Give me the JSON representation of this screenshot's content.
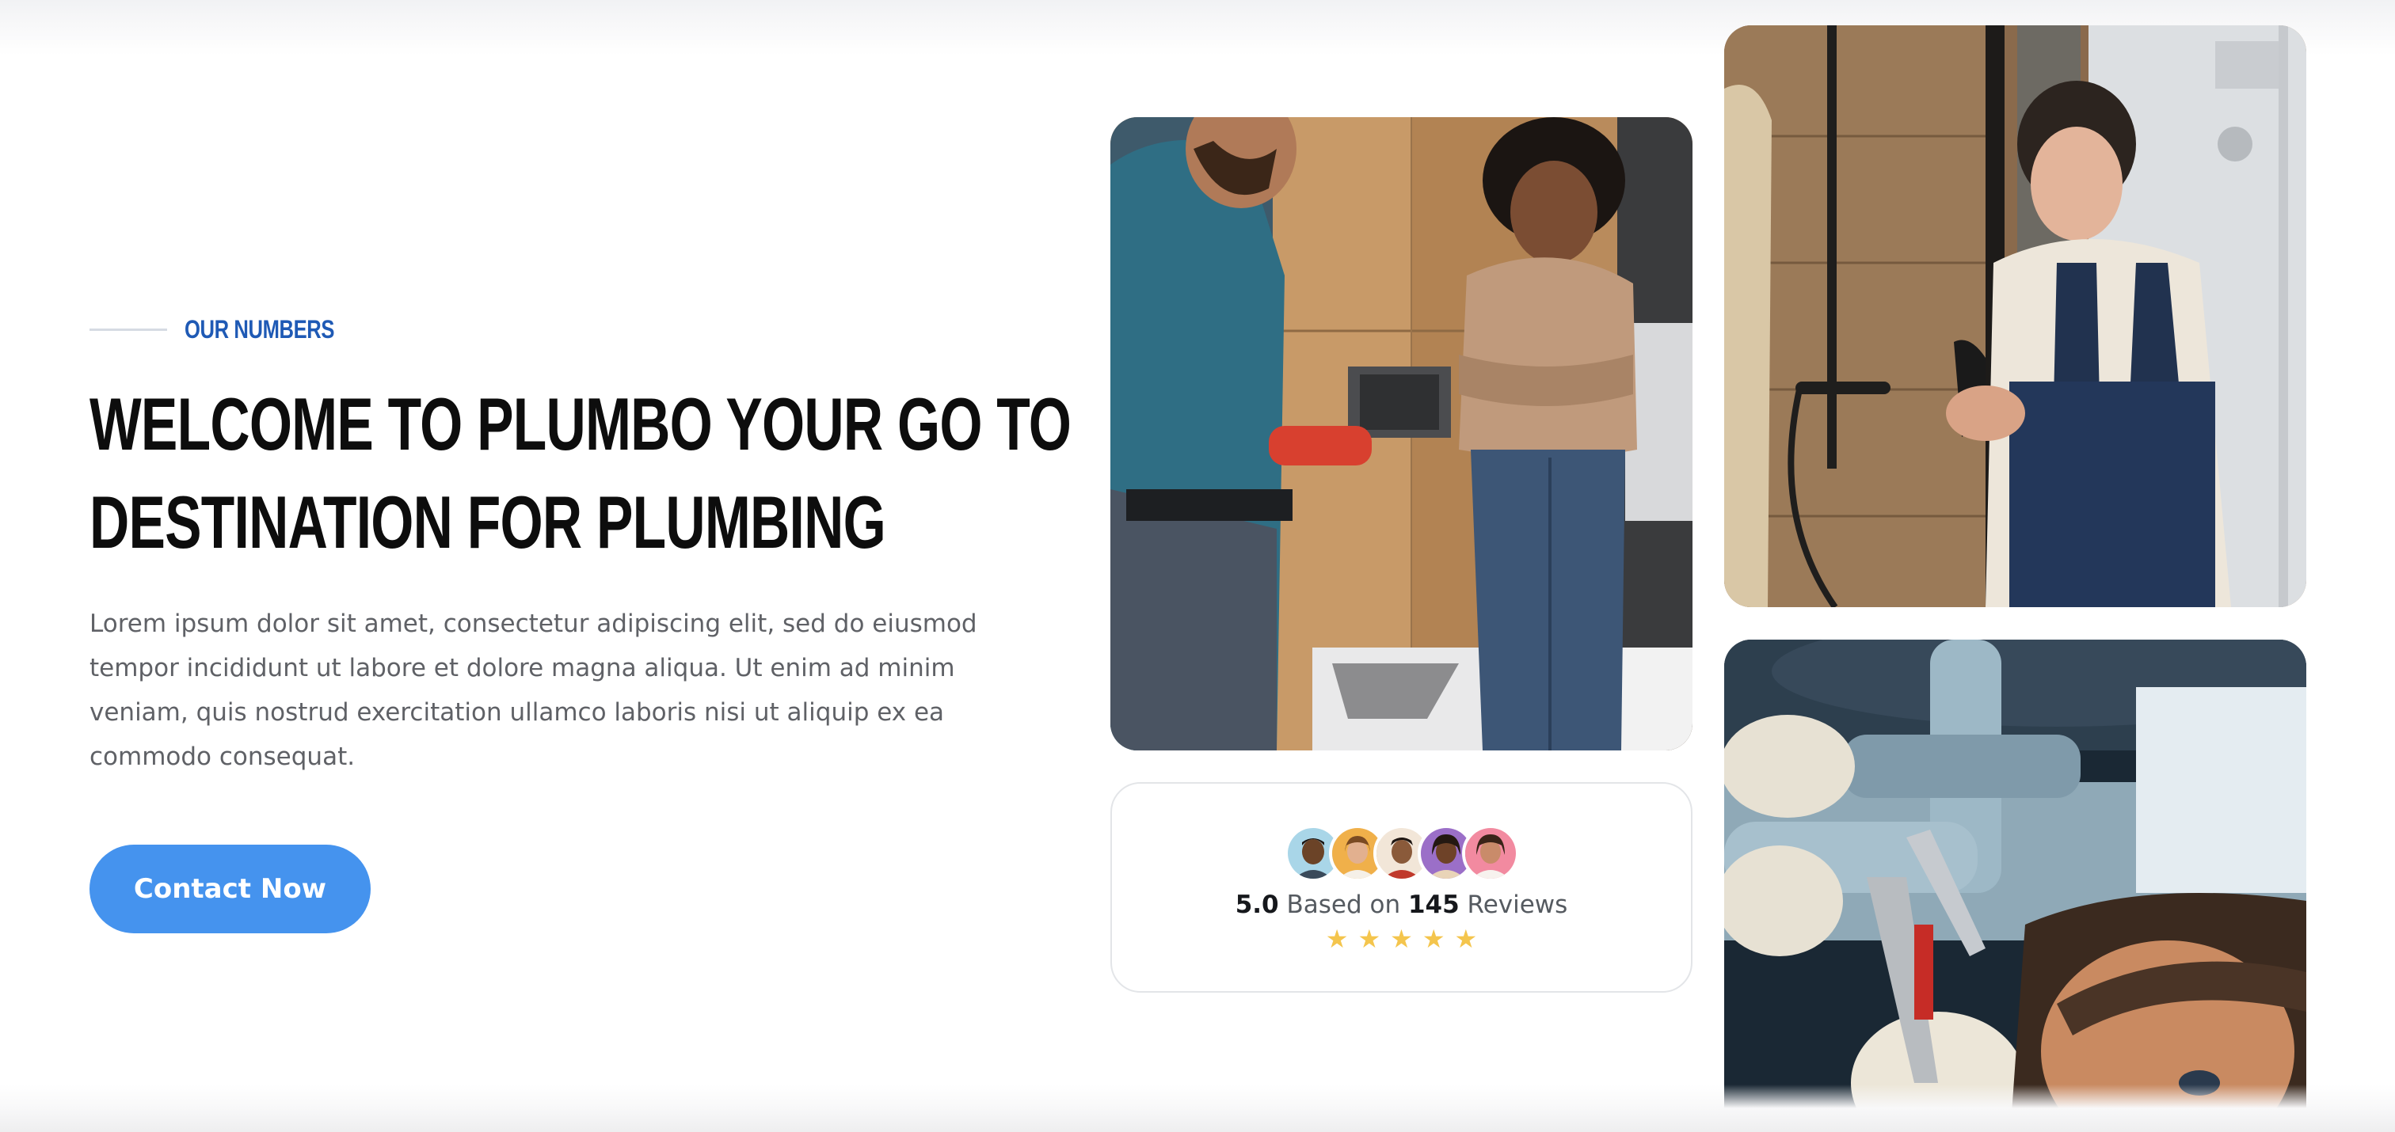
{
  "section": {
    "eyebrow": "OUR NUMBERS",
    "headline_line1": "WELCOME TO PLUMBO YOUR GO TO",
    "headline_line2": "DESTINATION FOR PLUMBING",
    "intro": "Lorem ipsum dolor sit amet, consectetur adipiscing elit, sed do eiusmod tempor incididunt ut labore et dolore magna aliqua. Ut enim ad minim veniam, quis nostrud exercitation ullamco laboris nisi ut aliquip ex ea commodo consequat.",
    "cta_label": "Contact Now"
  },
  "reviews": {
    "score": "5.0",
    "based_on": "Based on",
    "count": "145",
    "reviews_word": "Reviews",
    "stars": [
      "★",
      "★",
      "★",
      "★",
      "★"
    ],
    "star_rating": 5,
    "reviewer_count_shown": 5
  },
  "colors": {
    "accent": "#4593ee",
    "eyebrow": "#1f5ab5",
    "heading": "#0d0d0d",
    "body_text": "#5f6166",
    "star": "#f4c54d"
  },
  "images": {
    "photo_1": "plumber-and-customer-bathroom-photo",
    "photo_2": "plumber-fixing-shower-photo",
    "photo_3": "plumber-with-wrench-under-sink-photo"
  }
}
